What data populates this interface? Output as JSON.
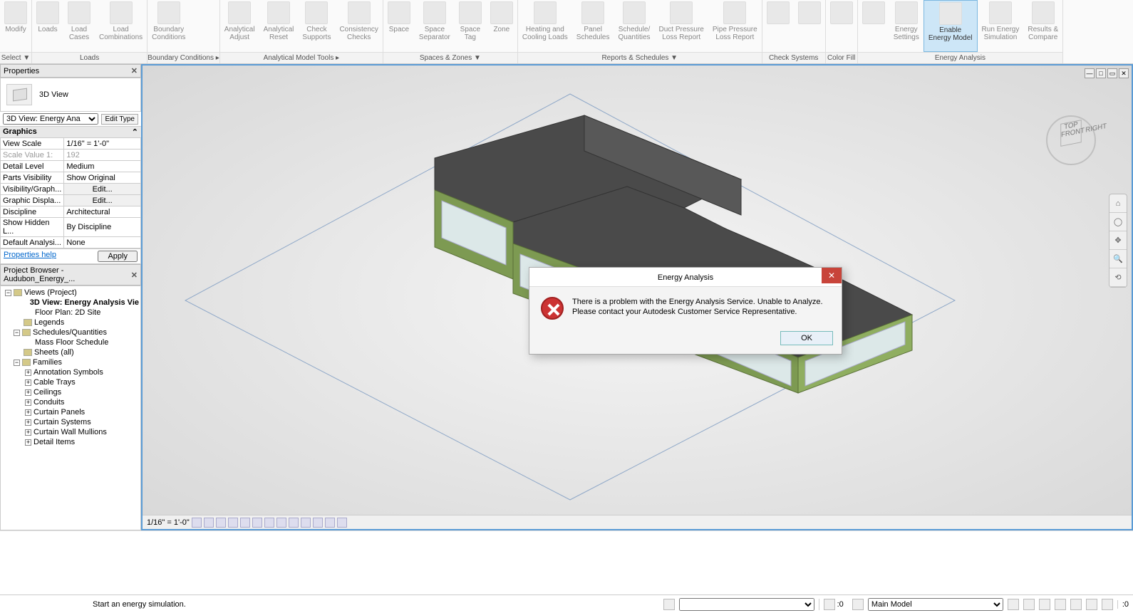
{
  "ribbon": {
    "groups": [
      {
        "label": "Select ▼",
        "buttons": [
          {
            "l": "Modify"
          }
        ]
      },
      {
        "label": "Loads",
        "buttons": [
          {
            "l": "Loads"
          },
          {
            "l": "Load\nCases"
          },
          {
            "l": "Load\nCombinations"
          }
        ]
      },
      {
        "label": "Boundary Conditions  ▸",
        "buttons": [
          {
            "l": "Boundary\nConditions"
          }
        ]
      },
      {
        "label": "Analytical Model Tools        ▸",
        "buttons": [
          {
            "l": "Analytical\nAdjust"
          },
          {
            "l": "Analytical\nReset"
          },
          {
            "l": "Check\nSupports"
          },
          {
            "l": "Consistency\nChecks"
          }
        ]
      },
      {
        "label": "Spaces & Zones ▼",
        "buttons": [
          {
            "l": "Space"
          },
          {
            "l": "Space\nSeparator"
          },
          {
            "l": "Space\nTag"
          },
          {
            "l": "Zone"
          }
        ]
      },
      {
        "label": "Reports & Schedules ▼",
        "buttons": [
          {
            "l": "Heating and\nCooling Loads"
          },
          {
            "l": "Panel\nSchedules"
          },
          {
            "l": "Schedule/\nQuantities"
          },
          {
            "l": "Duct Pressure\nLoss Report"
          },
          {
            "l": "Pipe Pressure\nLoss Report"
          }
        ]
      },
      {
        "label": "Check Systems",
        "buttons": [
          {
            "l": ""
          },
          {
            "l": ""
          }
        ]
      },
      {
        "label": "Color Fill",
        "buttons": [
          {
            "l": ""
          }
        ]
      },
      {
        "label": "Energy Analysis",
        "buttons": [
          {
            "l": ""
          },
          {
            "l": "Energy\nSettings"
          },
          {
            "l": "Enable\nEnergy Model",
            "active": true
          },
          {
            "l": "Run Energy\nSimulation"
          },
          {
            "l": "Results &\nCompare"
          }
        ]
      }
    ]
  },
  "properties": {
    "title": "Properties",
    "type": "3D View",
    "selector": "3D View: Energy Ana",
    "editType": "Edit Type",
    "groupGraphics": "Graphics",
    "rows": [
      {
        "k": "View Scale",
        "v": "1/16\" = 1'-0\""
      },
      {
        "k": "Scale Value   1:",
        "v": "192",
        "dim": true
      },
      {
        "k": "Detail Level",
        "v": "Medium"
      },
      {
        "k": "Parts Visibility",
        "v": "Show Original"
      },
      {
        "k": "Visibility/Graph...",
        "v": "Edit...",
        "btn": true
      },
      {
        "k": "Graphic Displa...",
        "v": "Edit...",
        "btn": true
      },
      {
        "k": "Discipline",
        "v": "Architectural"
      },
      {
        "k": "Show Hidden L...",
        "v": "By Discipline"
      },
      {
        "k": "Default Analysi...",
        "v": "None"
      }
    ],
    "help": "Properties help",
    "apply": "Apply"
  },
  "browser": {
    "title": "Project Browser - Audubon_Energy_...",
    "items": [
      {
        "t": "Views (Project)",
        "lvl": 0,
        "exp": "−",
        "ico": true
      },
      {
        "t": "3D View: Energy Analysis Vie",
        "lvl": 2,
        "bold": true
      },
      {
        "t": "Floor Plan: 2D Site",
        "lvl": 2
      },
      {
        "t": "Legends",
        "lvl": 1,
        "ico": true
      },
      {
        "t": "Schedules/Quantities",
        "lvl": 1,
        "exp": "−",
        "ico": true
      },
      {
        "t": "Mass Floor Schedule",
        "lvl": 2
      },
      {
        "t": "Sheets (all)",
        "lvl": 1,
        "ico": true
      },
      {
        "t": "Families",
        "lvl": 1,
        "exp": "−",
        "ico": true
      },
      {
        "t": "Annotation Symbols",
        "lvl": 2,
        "exp": "+"
      },
      {
        "t": "Cable Trays",
        "lvl": 2,
        "exp": "+"
      },
      {
        "t": "Ceilings",
        "lvl": 2,
        "exp": "+"
      },
      {
        "t": "Conduits",
        "lvl": 2,
        "exp": "+"
      },
      {
        "t": "Curtain Panels",
        "lvl": 2,
        "exp": "+"
      },
      {
        "t": "Curtain Systems",
        "lvl": 2,
        "exp": "+"
      },
      {
        "t": "Curtain Wall Mullions",
        "lvl": 2,
        "exp": "+"
      },
      {
        "t": "Detail Items",
        "lvl": 2,
        "exp": "+"
      }
    ]
  },
  "dialog": {
    "title": "Energy Analysis",
    "msg": "There is a problem with the Energy Analysis Service.  Unable to Analyze.\nPlease contact your Autodesk Customer Service Representative.",
    "ok": "OK"
  },
  "viewbar": {
    "scale": "1/16\" = 1'-0\""
  },
  "statusbar": {
    "hint": "Start an energy simulation.",
    "zeroLabel": ":0",
    "workset": "Main Model"
  },
  "viewcube": {
    "top": "TOP",
    "front": "FRONT",
    "right": "RIGHT"
  }
}
